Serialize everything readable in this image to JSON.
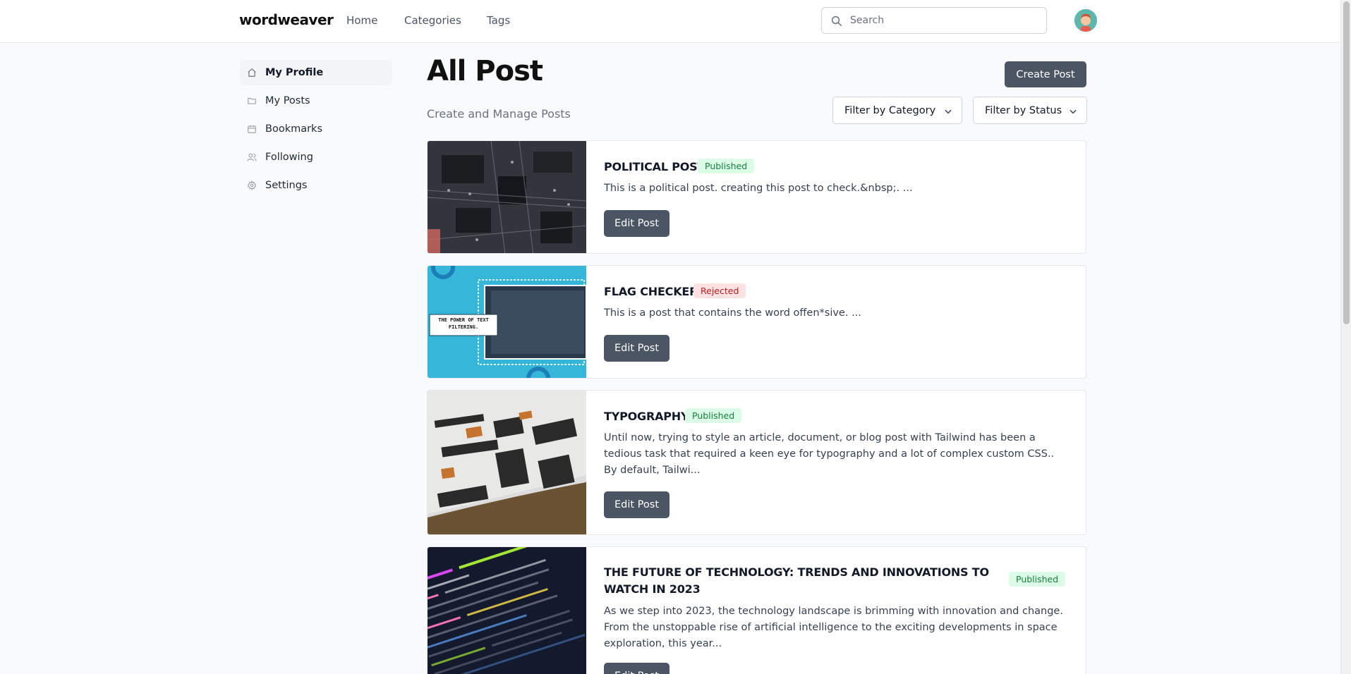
{
  "header": {
    "logo": "wordweaver",
    "nav": [
      "Home",
      "Categories",
      "Tags"
    ],
    "search_placeholder": "Search"
  },
  "sidebar": {
    "items": [
      {
        "label": "My Profile",
        "icon": "home-icon",
        "active": true
      },
      {
        "label": "My Posts",
        "icon": "folder-icon"
      },
      {
        "label": "Bookmarks",
        "icon": "calendar-icon"
      },
      {
        "label": "Following",
        "icon": "users-icon"
      },
      {
        "label": "Settings",
        "icon": "gear-icon"
      }
    ]
  },
  "main": {
    "title": "All Post",
    "subtitle": "Create and Manage Posts",
    "create_label": "Create Post",
    "filters": [
      "Filter by Category",
      "Filter by Status"
    ],
    "posts": [
      {
        "title": "POLITICAL POST",
        "status": "Published",
        "excerpt": "This is a political post. creating this post to check.&nbsp;. ...",
        "edit_label": "Edit Post"
      },
      {
        "title": "FLAG CHECKER",
        "status": "Rejected",
        "excerpt": "This is a post that contains the word offen*sive. ...",
        "edit_label": "Edit Post",
        "thumb_text": "THE POWER OF TEXT FILTERING."
      },
      {
        "title": "TYPOGRAPHY",
        "status": "Published",
        "excerpt": "Until now, trying to style an article, document, or blog post with Tailwind has been a tedious task that required a keen eye for typography and a lot of complex custom CSS.. By default, Tailwi...",
        "edit_label": "Edit Post"
      },
      {
        "title": "THE FUTURE OF TECHNOLOGY: TRENDS AND INNOVATIONS TO WATCH IN 2023",
        "status": "Published",
        "excerpt": "As we step into 2023, the technology landscape is brimming with innovation and change. From the unstoppable rise of artificial intelligence to the exciting developments in space exploration, this year...",
        "edit_label": "Edit Post"
      }
    ]
  },
  "colors": {
    "button": "#4b5563",
    "published_bg": "#dcfce7",
    "published_text": "#15803d",
    "rejected_bg": "#fee2e2",
    "rejected_text": "#b91c1c"
  }
}
